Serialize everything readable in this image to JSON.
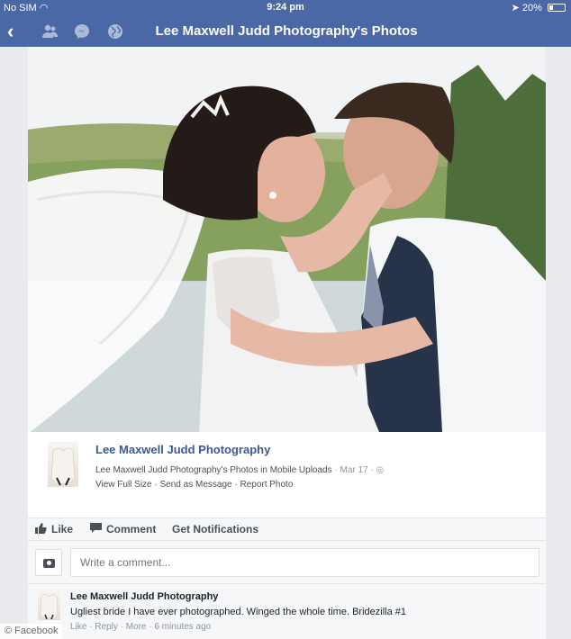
{
  "status_bar": {
    "carrier": "No SIM",
    "time": "9:24 pm",
    "battery": "20%"
  },
  "nav": {
    "title": "Lee Maxwell Judd Photography's Photos",
    "icons": [
      "back-icon",
      "friends-icon",
      "messenger-icon",
      "globe-icon"
    ]
  },
  "post": {
    "author": "Lee Maxwell Judd Photography",
    "album": "Lee Maxwell Judd Photography's Photos in Mobile Uploads",
    "date": "Mar 17",
    "links": [
      "View Full Size",
      "Send as Message",
      "Report Photo"
    ]
  },
  "actions": {
    "like": "Like",
    "comment": "Comment",
    "notifications": "Get Notifications"
  },
  "composer": {
    "placeholder": "Write a comment..."
  },
  "comment": {
    "author": "Lee Maxwell Judd Photography",
    "text": "Ugliest bride I have ever photographed. Winged the whole time. Bridezilla #1",
    "like": "Like",
    "reply": "Reply",
    "more": "More",
    "time": "6 minutes ago"
  },
  "watermark": "© Facebook",
  "colors": {
    "brand": "#4a67a6",
    "link": "#3b5998"
  }
}
